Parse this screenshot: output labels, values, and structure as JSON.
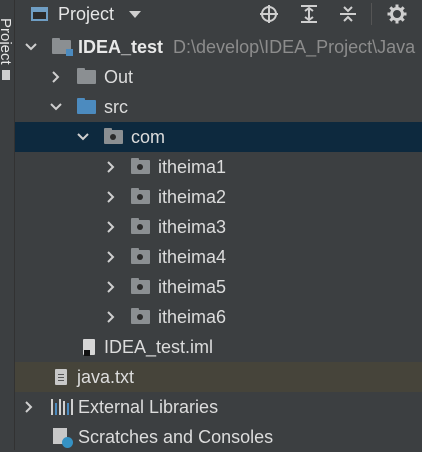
{
  "side_strip": {
    "label": "Project"
  },
  "header": {
    "title": "Project",
    "icons": [
      "locate-icon",
      "expand-all-icon",
      "collapse-all-icon",
      "settings-icon"
    ]
  },
  "tree": {
    "root": {
      "name": "IDEA_test",
      "path": "D:\\develop\\IDEA_Project\\Java"
    },
    "out": "Out",
    "src": "src",
    "com": "com",
    "packages": [
      "itheima1",
      "itheima2",
      "itheima3",
      "itheima4",
      "itheima5",
      "itheima6"
    ],
    "iml": "IDEA_test.iml",
    "txt": "java.txt",
    "libraries": "External Libraries",
    "scratches": "Scratches and Consoles"
  },
  "colors": {
    "background": "#3c3f41",
    "selected_row": "#0d293e",
    "highlight_row": "#46443a",
    "folder": "#8b8f92",
    "source_folder": "#4c8bbf"
  }
}
